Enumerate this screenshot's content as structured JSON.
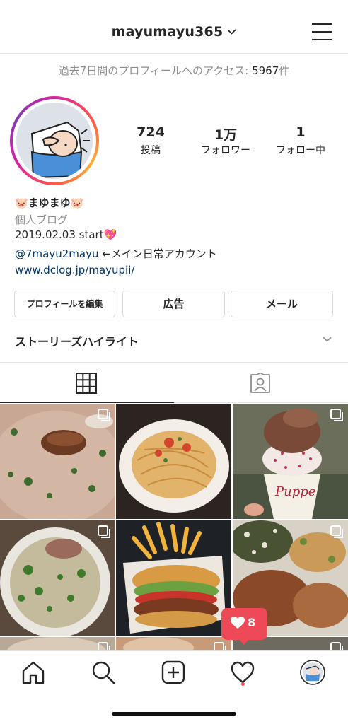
{
  "header": {
    "username": "mayumayu365"
  },
  "access_banner": {
    "text": "過去7日間のプロフィールへのアクセス: ",
    "count": "5967",
    "suffix": "件"
  },
  "stats": [
    {
      "value": "724",
      "label": "投稿"
    },
    {
      "value": "1万",
      "label": "フォロワー"
    },
    {
      "value": "1",
      "label": "フォロー中"
    }
  ],
  "bio": {
    "name": "🐷まゆまゆ🐷",
    "category": "個人ブログ",
    "line1": "2019.02.03 start💖",
    "mention": "@7mayu2mayu",
    "mention_suffix": " ←メイン日常アカウント",
    "website": "www.dclog.jp/mayupii/"
  },
  "buttons": {
    "edit": "プロフィールを編集",
    "ads": "広告",
    "mail": "メール"
  },
  "highlights": {
    "label": "ストーリーズハイライト"
  },
  "notification": {
    "likes": "8"
  },
  "colors": {
    "link": "#003569",
    "notification": "#ed4956",
    "muted": "#8e8e8e"
  },
  "icons": [
    "chevron-down-icon",
    "menu-icon",
    "grid-icon",
    "tagged-icon",
    "home-icon",
    "search-icon",
    "new-post-icon",
    "activity-icon",
    "profile-avatar-icon",
    "heart-icon",
    "multiple-photos-icon"
  ]
}
